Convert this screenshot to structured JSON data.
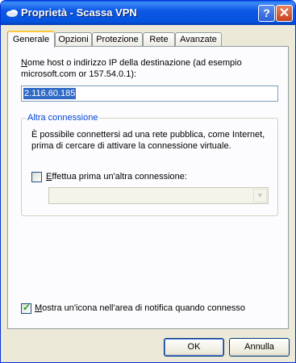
{
  "window": {
    "title": "Proprietà - Scassa VPN",
    "help_label": "?",
    "close_label": "✕"
  },
  "tabs": [
    {
      "label": "Generale"
    },
    {
      "label": "Opzioni"
    },
    {
      "label": "Protezione"
    },
    {
      "label": "Rete"
    },
    {
      "label": "Avanzate"
    }
  ],
  "general": {
    "host_label_line1_underlined": "N",
    "host_label_line1_rest": "ome host o indirizzo IP della destinazione (ad esempio",
    "host_label_line2": "microsoft.com or 157.54.0.1):",
    "host_value": "2.116.60.185",
    "group_title": "Altra connessione",
    "group_desc_line1": "È possibile connettersi ad una rete pubblica, come Internet,",
    "group_desc_line2": "prima di cercare di attivare la connessione virtuale.",
    "first_connect_underlined": "E",
    "first_connect_rest": "ffettua prima un'altra connessione:",
    "first_connect_checked": false,
    "first_connect_combo_value": "",
    "notify_underlined": "M",
    "notify_rest": "ostra un'icona nell'area di notifica quando connesso",
    "notify_checked": true
  },
  "buttons": {
    "ok": "OK",
    "cancel": "Annulla"
  },
  "colors": {
    "titlebar": "#0453dd",
    "dialog_bg": "#ece9d8",
    "panel_bg": "#fcfcfe",
    "group_title": "#0046d5",
    "selection": "#316ac5",
    "check": "#21a121"
  },
  "icons": {
    "title_icon": "network-cloud-icon",
    "help": "help-icon",
    "close": "close-icon",
    "combo_arrow": "chevron-down-icon",
    "check": "checkmark-icon"
  }
}
